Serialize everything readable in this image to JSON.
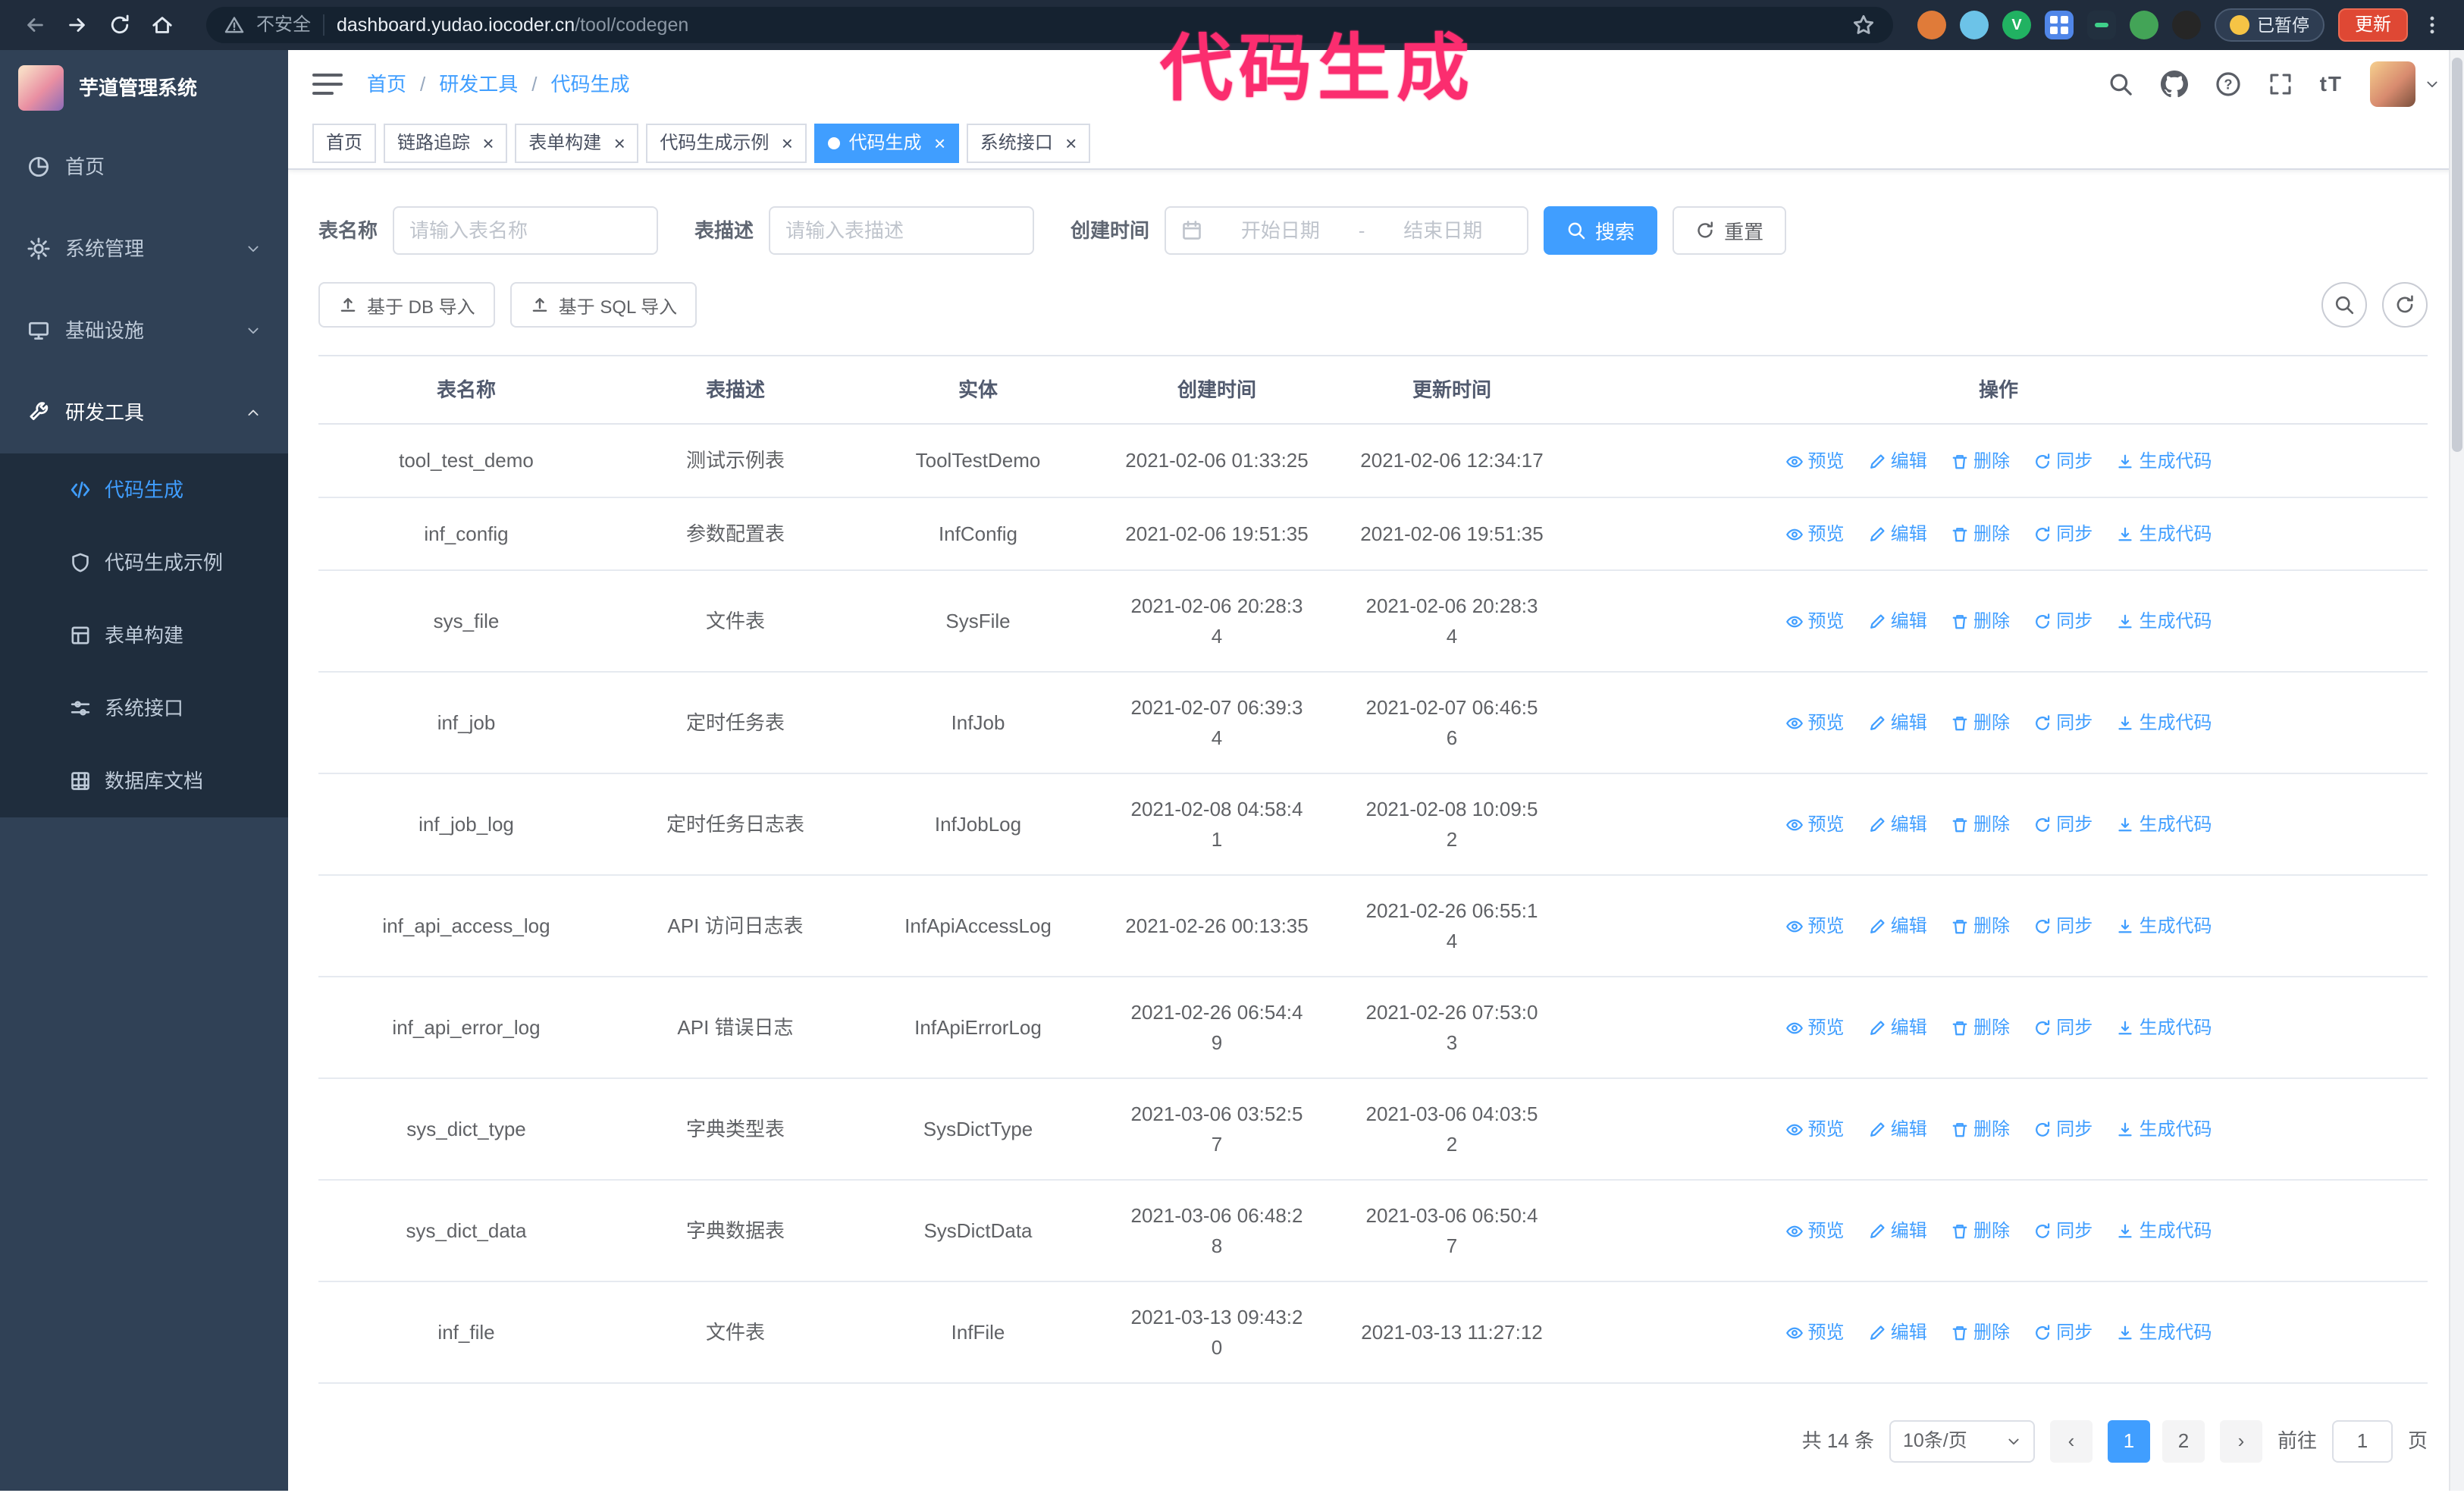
{
  "colors": {
    "accent": "#409eff",
    "annotation": "#fb2d6f",
    "sidebar_bg": "#304156",
    "submenu_bg": "#1f2d3d",
    "chrome_bg": "#202c3c",
    "update_button_bg": "#df4834"
  },
  "icons": {
    "close_x": "×"
  },
  "annotation": {
    "text": "代码生成"
  },
  "browser": {
    "security_label": "不安全",
    "url_host": "dashboard.yudao.iocoder.cn",
    "url_path": "/tool/codegen",
    "paused_badge": "已暂停",
    "update_button": "更新"
  },
  "sidebar": {
    "logo_title": "芋道管理系统",
    "items": [
      {
        "label": "首页"
      },
      {
        "label": "系统管理"
      },
      {
        "label": "基础设施"
      },
      {
        "label": "研发工具"
      }
    ],
    "sub_items": [
      {
        "label": "代码生成"
      },
      {
        "label": "代码生成示例"
      },
      {
        "label": "表单构建"
      },
      {
        "label": "系统接口"
      },
      {
        "label": "数据库文档"
      }
    ]
  },
  "header": {
    "breadcrumb": [
      "首页",
      "研发工具",
      "代码生成"
    ],
    "breadcrumb_separator": "/",
    "font_size_icon": "tT"
  },
  "tabs": [
    {
      "label": "首页",
      "closable": false,
      "active": false
    },
    {
      "label": "链路追踪",
      "closable": true,
      "active": false
    },
    {
      "label": "表单构建",
      "closable": true,
      "active": false
    },
    {
      "label": "代码生成示例",
      "closable": true,
      "active": false
    },
    {
      "label": "代码生成",
      "closable": true,
      "active": true
    },
    {
      "label": "系统接口",
      "closable": true,
      "active": false
    }
  ],
  "filters": {
    "table_name_label": "表名称",
    "table_name_placeholder": "请输入表名称",
    "table_desc_label": "表描述",
    "table_desc_placeholder": "请输入表描述",
    "create_time_label": "创建时间",
    "date_start_placeholder": "开始日期",
    "date_separator": "-",
    "date_end_placeholder": "结束日期",
    "search_button": "搜索",
    "reset_button": "重置"
  },
  "toolbar": {
    "import_db_button": "基于 DB 导入",
    "import_sql_button": "基于 SQL 导入"
  },
  "table": {
    "columns": [
      "表名称",
      "表描述",
      "实体",
      "创建时间",
      "更新时间",
      "操作"
    ],
    "actions": [
      "预览",
      "编辑",
      "删除",
      "同步",
      "生成代码"
    ],
    "rows": [
      {
        "name": "tool_test_demo",
        "desc": "测试示例表",
        "entity": "ToolTestDemo",
        "create_time": "2021-02-06 01:33:25",
        "update_time": "2021-02-06 12:34:17"
      },
      {
        "name": "inf_config",
        "desc": "参数配置表",
        "entity": "InfConfig",
        "create_time": "2021-02-06 19:51:35",
        "update_time": "2021-02-06 19:51:35"
      },
      {
        "name": "sys_file",
        "desc": "文件表",
        "entity": "SysFile",
        "create_time": "2021-02-06 20:28:3\n4",
        "update_time": "2021-02-06 20:28:3\n4"
      },
      {
        "name": "inf_job",
        "desc": "定时任务表",
        "entity": "InfJob",
        "create_time": "2021-02-07 06:39:3\n4",
        "update_time": "2021-02-07 06:46:5\n6"
      },
      {
        "name": "inf_job_log",
        "desc": "定时任务日志表",
        "entity": "InfJobLog",
        "create_time": "2021-02-08 04:58:4\n1",
        "update_time": "2021-02-08 10:09:5\n2"
      },
      {
        "name": "inf_api_access_log",
        "desc": "API 访问日志表",
        "entity": "InfApiAccessLog",
        "create_time": "2021-02-26 00:13:35",
        "update_time": "2021-02-26 06:55:1\n4"
      },
      {
        "name": "inf_api_error_log",
        "desc": "API 错误日志",
        "entity": "InfApiErrorLog",
        "create_time": "2021-02-26 06:54:4\n9",
        "update_time": "2021-02-26 07:53:0\n3"
      },
      {
        "name": "sys_dict_type",
        "desc": "字典类型表",
        "entity": "SysDictType",
        "create_time": "2021-03-06 03:52:5\n7",
        "update_time": "2021-03-06 04:03:5\n2"
      },
      {
        "name": "sys_dict_data",
        "desc": "字典数据表",
        "entity": "SysDictData",
        "create_time": "2021-03-06 06:48:2\n8",
        "update_time": "2021-03-06 06:50:4\n7"
      },
      {
        "name": "inf_file",
        "desc": "文件表",
        "entity": "InfFile",
        "create_time": "2021-03-13 09:43:2\n0",
        "update_time": "2021-03-13 11:27:12"
      }
    ]
  },
  "pagination": {
    "total_text": "共 14 条",
    "page_size": "10条/页",
    "pages": [
      "1",
      "2"
    ],
    "active_page": "1",
    "prev_icon": "‹",
    "next_icon": "›",
    "goto_label": "前往",
    "goto_value": "1",
    "goto_suffix": "页"
  }
}
